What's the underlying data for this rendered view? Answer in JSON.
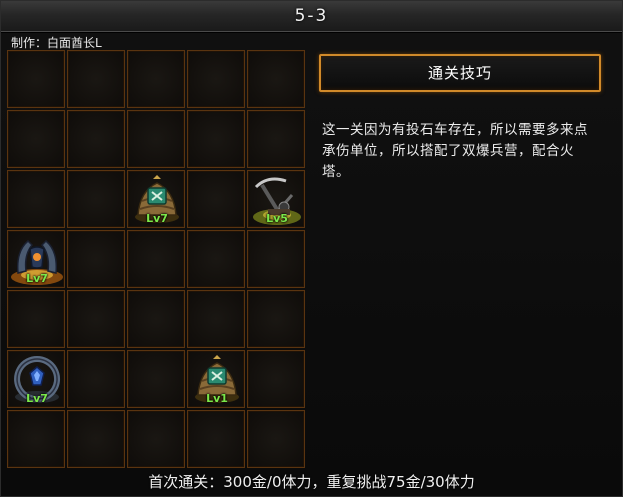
{
  "title": "5-3",
  "author": "制作：白面酋长L",
  "tips": {
    "button_label": "通关技巧",
    "text": "这一关因为有投石车存在，所以需要多来点承伤单位，所以搭配了双爆兵营，配合火塔。"
  },
  "footer": "首次通关：300金/0体力，重复挑战75金/30体力",
  "grid": {
    "rows": 7,
    "cols": 5,
    "units": [
      {
        "row": 3,
        "col": 3,
        "icon": "barracks-icon",
        "level": "Lv7"
      },
      {
        "row": 3,
        "col": 5,
        "icon": "catapult-icon",
        "level": "Lv5"
      },
      {
        "row": 4,
        "col": 1,
        "icon": "fire-tower-icon",
        "level": "Lv7"
      },
      {
        "row": 6,
        "col": 1,
        "icon": "ice-tower-icon",
        "level": "Lv7"
      },
      {
        "row": 6,
        "col": 4,
        "icon": "barracks-icon",
        "level": "Lv1"
      }
    ]
  },
  "colors": {
    "cell_border": "#5a3410",
    "button_border": "#d18a2a",
    "level_text": "#7be84a"
  }
}
